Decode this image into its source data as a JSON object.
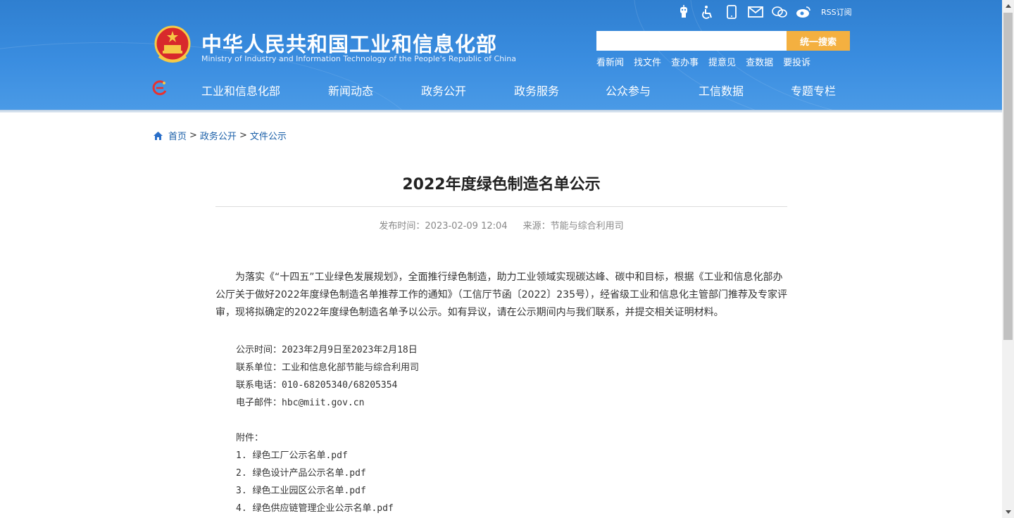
{
  "header": {
    "title_cn": "中华人民共和国工业和信息化部",
    "title_en": "Ministry of Industry and Information Technology of the People's Republic of China",
    "top_icons": [
      "robot-icon",
      "accessibility-icon",
      "mobile-icon",
      "mail-icon",
      "wechat-icon",
      "weibo-icon"
    ],
    "rss_label": "RSS订阅",
    "search_placeholder": "",
    "search_button": "统一搜索",
    "quick_links": [
      "看新闻",
      "找文件",
      "查办事",
      "提意见",
      "查数据",
      "要投诉"
    ]
  },
  "nav": {
    "items": [
      "工业和信息化部",
      "新闻动态",
      "政务公开",
      "政务服务",
      "公众参与",
      "工信数据",
      "专题专栏"
    ]
  },
  "breadcrumb": [
    "首页",
    "政务公开",
    "文件公示"
  ],
  "breadcrumb_sep": ">",
  "article": {
    "title": "2022年度绿色制造名单公示",
    "publish_time": "发布时间：2023-02-09 12:04",
    "source": "来源：节能与综合利用司",
    "paragraph": "为落实《“十四五”工业绿色发展规划》，全面推行绿色制造，助力工业领域实现碳达峰、碳中和目标，根据《工业和信息化部办公厅关于做好2022年度绿色制造名单推荐工作的通知》（工信厅节函〔2022〕235号），经省级工业和信息化主管部门推荐及专家评审，现将拟确定的2022年度绿色制造名单予以公示。如有异议，请在公示期间内与我们联系，并提交相关证明材料。",
    "info_lines": [
      "公示时间：2023年2月9日至2023年2月18日",
      "联系单位：工业和信息化部节能与综合利用司",
      "联系电话：010-68205340/68205354",
      "电子邮件：hbc@miit.gov.cn"
    ],
    "attachments_label": "附件：",
    "attachments": [
      "1. 绿色工厂公示名单.pdf",
      "2. 绿色设计产品公示名单.pdf",
      "3. 绿色工业园区公示名单.pdf",
      "4. 绿色供应链管理企业公示名单.pdf"
    ]
  },
  "colors": {
    "header_blue": "#3a8de0",
    "search_button": "#f4b040",
    "link_blue": "#1a5fa8"
  }
}
